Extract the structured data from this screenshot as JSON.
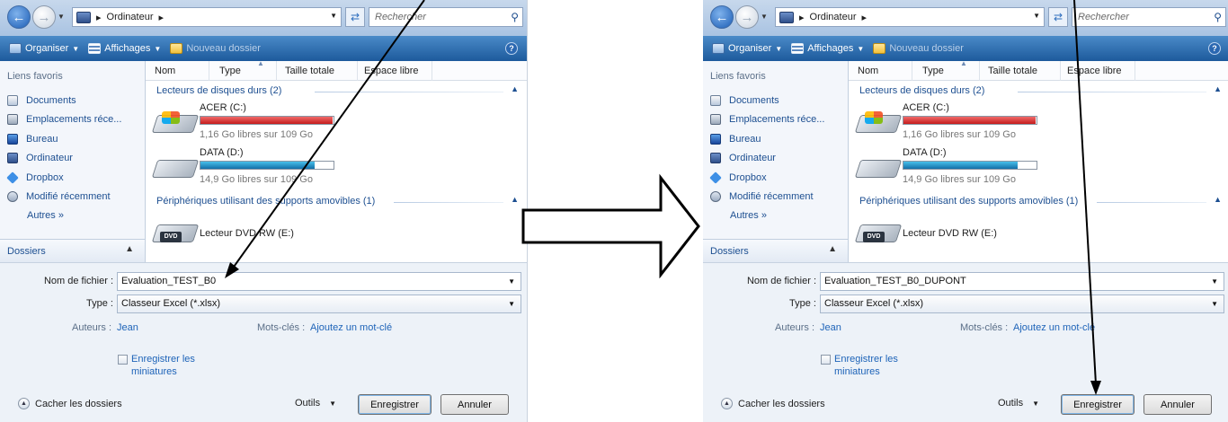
{
  "dialogs": [
    {
      "address": {
        "path": "Ordinateur",
        "search_placeholder": "Rechercher"
      },
      "toolbar": {
        "organize": "Organiser",
        "views": "Affichages",
        "new_folder": "Nouveau dossier"
      },
      "nav": {
        "heading": "Liens favoris",
        "items": [
          {
            "label": "Documents",
            "icon": "documents-icon"
          },
          {
            "label": "Emplacements réce...",
            "icon": "recent-places-icon"
          },
          {
            "label": "Bureau",
            "icon": "desktop-icon"
          },
          {
            "label": "Ordinateur",
            "icon": "computer-icon"
          },
          {
            "label": "Dropbox",
            "icon": "dropbox-icon"
          },
          {
            "label": "Modifié récemment",
            "icon": "recently-modified-icon"
          }
        ],
        "more": "Autres »",
        "folders": "Dossiers"
      },
      "columns": [
        "Nom",
        "Type",
        "Taille totale",
        "Espace libre"
      ],
      "groups": {
        "hdd": "Lecteurs de disques durs (2)",
        "removable": "Périphériques utilisant des supports amovibles (1)"
      },
      "drives": [
        {
          "name": "ACER (C:)",
          "free": "1,16 Go libres sur 109 Go",
          "used_fraction": 0.99,
          "bar_color": "#d42a2a"
        },
        {
          "name": "DATA (D:)",
          "free": "14,9 Go libres sur 109 Go",
          "used_fraction": 0.86,
          "bar_color": "#1f86c4"
        }
      ],
      "dvd": {
        "name": "Lecteur DVD RW (E:)",
        "badge": "DVD"
      },
      "form": {
        "filename_label": "Nom de fichier :",
        "filename_value": "Evaluation_TEST_B0",
        "type_label": "Type :",
        "type_value": "Classeur Excel (*.xlsx)",
        "authors_label": "Auteurs :",
        "authors_value": "Jean",
        "keywords_label": "Mots-clés :",
        "keywords_value": "Ajoutez un mot-clé",
        "thumb_label": "Enregistrer les miniatures",
        "hide_folders": "Cacher les dossiers",
        "tools": "Outils",
        "save": "Enregistrer",
        "cancel": "Annuler"
      }
    },
    {
      "address": {
        "path": "Ordinateur",
        "search_placeholder": "Rechercher"
      },
      "toolbar": {
        "organize": "Organiser",
        "views": "Affichages",
        "new_folder": "Nouveau dossier"
      },
      "nav": {
        "heading": "Liens favoris",
        "items": [
          {
            "label": "Documents",
            "icon": "documents-icon"
          },
          {
            "label": "Emplacements réce...",
            "icon": "recent-places-icon"
          },
          {
            "label": "Bureau",
            "icon": "desktop-icon"
          },
          {
            "label": "Ordinateur",
            "icon": "computer-icon"
          },
          {
            "label": "Dropbox",
            "icon": "dropbox-icon"
          },
          {
            "label": "Modifié récemment",
            "icon": "recently-modified-icon"
          }
        ],
        "more": "Autres »",
        "folders": "Dossiers"
      },
      "columns": [
        "Nom",
        "Type",
        "Taille totale",
        "Espace libre"
      ],
      "groups": {
        "hdd": "Lecteurs de disques durs (2)",
        "removable": "Périphériques utilisant des supports amovibles (1)"
      },
      "drives": [
        {
          "name": "ACER (C:)",
          "free": "1,16 Go libres sur 109 Go",
          "used_fraction": 0.99,
          "bar_color": "#d42a2a"
        },
        {
          "name": "DATA (D:)",
          "free": "14,9 Go libres sur 109 Go",
          "used_fraction": 0.86,
          "bar_color": "#1f86c4"
        }
      ],
      "dvd": {
        "name": "Lecteur DVD RW (E:)",
        "badge": "DVD"
      },
      "form": {
        "filename_label": "Nom de fichier :",
        "filename_value": "Evaluation_TEST_B0_DUPONT",
        "type_label": "Type :",
        "type_value": "Classeur Excel (*.xlsx)",
        "authors_label": "Auteurs :",
        "authors_value": "Jean",
        "keywords_label": "Mots-clés :",
        "keywords_value": "Ajoutez un mot-clé",
        "thumb_label": "Enregistrer les miniatures",
        "hide_folders": "Cacher les dossiers",
        "tools": "Outils",
        "save": "Enregistrer",
        "cancel": "Annuler"
      }
    }
  ],
  "colors": {
    "toolbar": "#2b6bb0",
    "link": "#1d63b8",
    "arrow": "#000000"
  }
}
